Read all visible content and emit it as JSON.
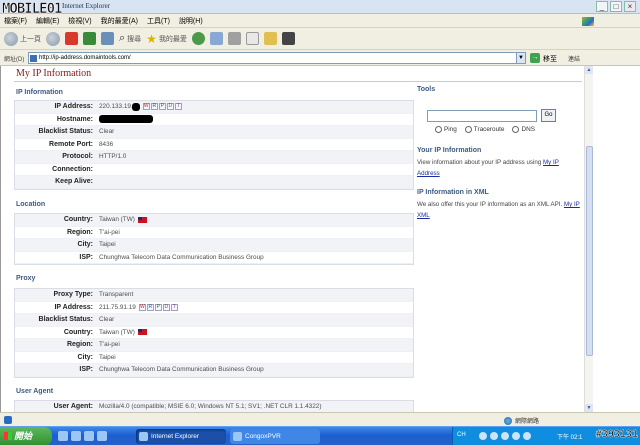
{
  "window": {
    "title": "Internet Explorer",
    "watermark": "MOBILE01",
    "min": "_",
    "max": "□",
    "close": "×"
  },
  "menu": [
    "檔案(F)",
    "編輯(E)",
    "檢視(V)",
    "我的最愛(A)",
    "工具(T)",
    "說明(H)"
  ],
  "toolbar": {
    "back": "上一頁",
    "search": "搜尋",
    "favorites": "我的最愛"
  },
  "address": {
    "label": "網址(D)",
    "url": "http://ip-address.domaintools.com/",
    "go": "移至",
    "links": "連結"
  },
  "page": {
    "title": "My IP Information",
    "ip_section": {
      "heading": "IP Information",
      "rows": [
        {
          "label": "IP Address:",
          "value": "220.133.19."
        },
        {
          "label": "Hostname:",
          "value": ""
        },
        {
          "label": "Blacklist Status:",
          "value": "Clear"
        },
        {
          "label": "Remote Port:",
          "value": "8436"
        },
        {
          "label": "Protocol:",
          "value": "HTTP/1.0"
        },
        {
          "label": "Connection:",
          "value": ""
        },
        {
          "label": "Keep Alive:",
          "value": ""
        }
      ]
    },
    "location_section": {
      "heading": "Location",
      "rows": [
        {
          "label": "Country:",
          "value": "Taiwan (TW)"
        },
        {
          "label": "Region:",
          "value": "T'ai-pei"
        },
        {
          "label": "City:",
          "value": "Taipei"
        },
        {
          "label": "ISP:",
          "value": "Chunghwa Telecom Data Communication Business Group"
        }
      ]
    },
    "proxy_section": {
      "heading": "Proxy",
      "rows": [
        {
          "label": "Proxy Type:",
          "value": "Transparent"
        },
        {
          "label": "IP Address:",
          "value": "211.75.91.19"
        },
        {
          "label": "Blacklist Status:",
          "value": "Clear"
        },
        {
          "label": "Country:",
          "value": "Taiwan (TW)"
        },
        {
          "label": "Region:",
          "value": "T'ai-pei"
        },
        {
          "label": "City:",
          "value": "Taipei"
        },
        {
          "label": "ISP:",
          "value": "Chunghwa Telecom Data Communication Business Group"
        }
      ]
    },
    "ua_section": {
      "heading": "User Agent",
      "rows": [
        {
          "label": "User Agent:",
          "value": "Mozilla/4.0 (compatible; MSIE 6.0; Windows NT 5.1; SV1; .NET CLR 1.1.4322)"
        }
      ]
    },
    "badges": [
      "W",
      "R",
      "P",
      "D",
      "T"
    ],
    "tools": {
      "heading": "Tools",
      "go": "Go",
      "radios": [
        "Ping",
        "Traceroute",
        "DNS"
      ]
    },
    "your_ip": {
      "heading": "Your IP Information",
      "text": "View information about your IP address using",
      "link": "My IP Address"
    },
    "ip_xml": {
      "heading": "IP Information in XML",
      "text": "We also offer this your IP information as an XML API.",
      "link": "My IP XML"
    }
  },
  "status": {
    "zone": "網際網路"
  },
  "taskbar": {
    "start": "開始",
    "tasks": [
      "Internet Explorer",
      "CongoxPVR"
    ],
    "lang": "CH",
    "clock": "下午 02:1",
    "watermark": "#393131"
  }
}
